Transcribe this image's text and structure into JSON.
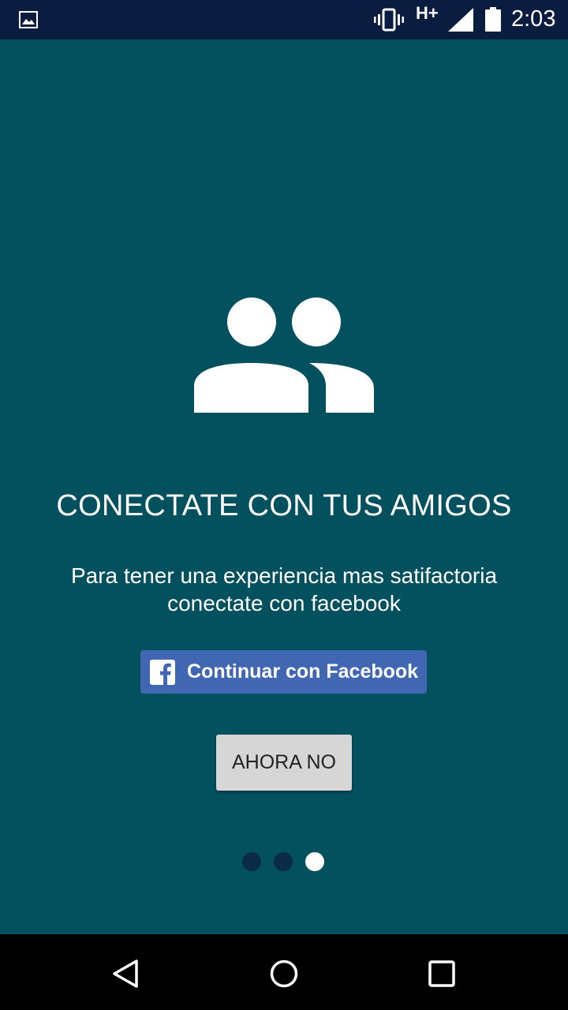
{
  "status_bar": {
    "network_type": "H+",
    "time": "2:03",
    "icons": [
      "gallery-icon",
      "vibrate-icon",
      "signal-icon",
      "battery-icon"
    ]
  },
  "onboarding": {
    "icon": "people-icon",
    "title": "CONECTATE CON TUS AMIGOS",
    "subtitle_line1": "Para tener una experiencia mas satifactoria",
    "subtitle_line2": "conectate con facebook",
    "facebook_button_label": "Continuar con Facebook",
    "skip_button_label": "AHORA NO",
    "page_indicator": {
      "total": 3,
      "current": 3
    }
  },
  "nav_bar": {
    "icons": [
      "back-icon",
      "home-icon",
      "recents-icon"
    ]
  },
  "colors": {
    "background": "#03505f",
    "status_bar": "#0a1c3f",
    "facebook_blue": "#4267b2",
    "skip_button": "#d6d6d6",
    "dot_inactive": "#0a2a48",
    "dot_active": "#ffffff"
  }
}
